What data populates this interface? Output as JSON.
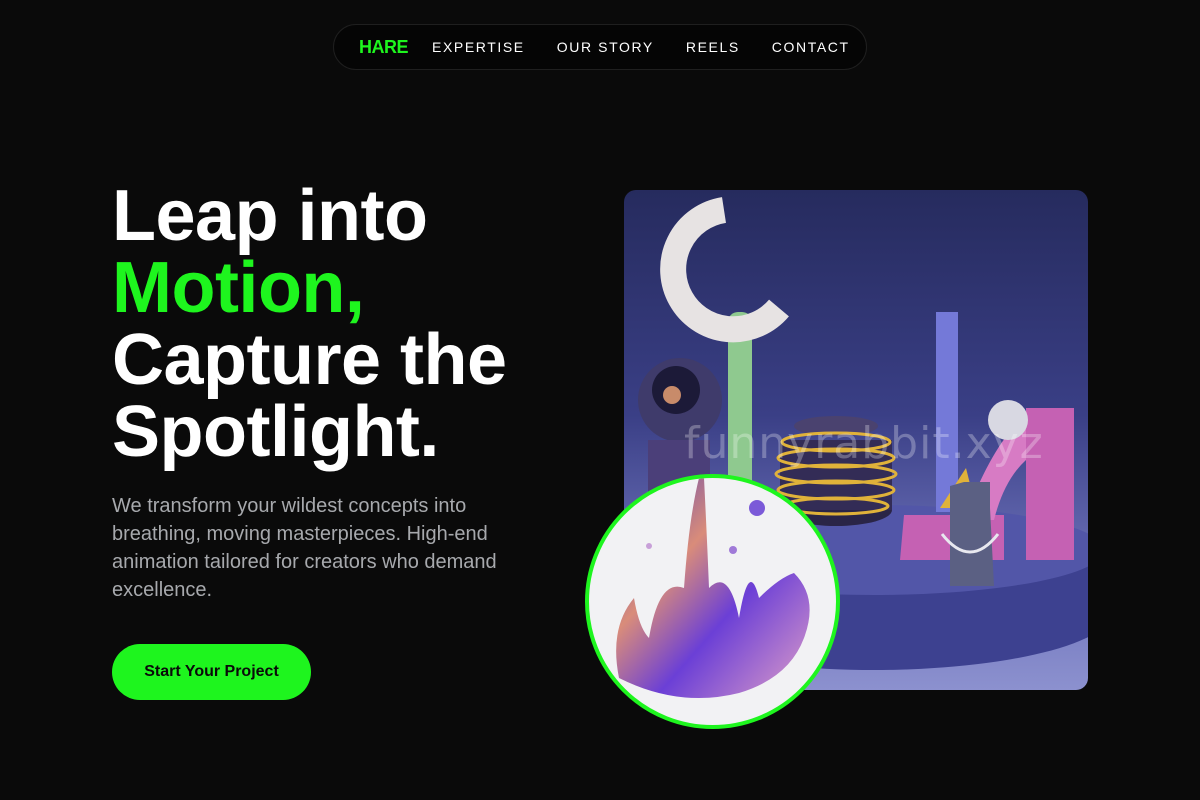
{
  "nav": {
    "brand": "HARE",
    "links": [
      "EXPERTISE",
      "OUR STORY",
      "REELS",
      "CONTACT"
    ]
  },
  "hero": {
    "headline_line1": "Leap into",
    "headline_accent": "Motion,",
    "headline_line3": "Capture the",
    "headline_line4": "Spotlight.",
    "description": "We transform your wildest concepts into breathing, moving masterpieces. High-end animation tailored for creators who demand excellence.",
    "cta_label": "Start Your Project"
  },
  "watermark": "funnyrabbit.xyz",
  "colors": {
    "accent": "#1ef51e",
    "background": "#0a0a0a",
    "body_text": "#a7a9ad"
  }
}
